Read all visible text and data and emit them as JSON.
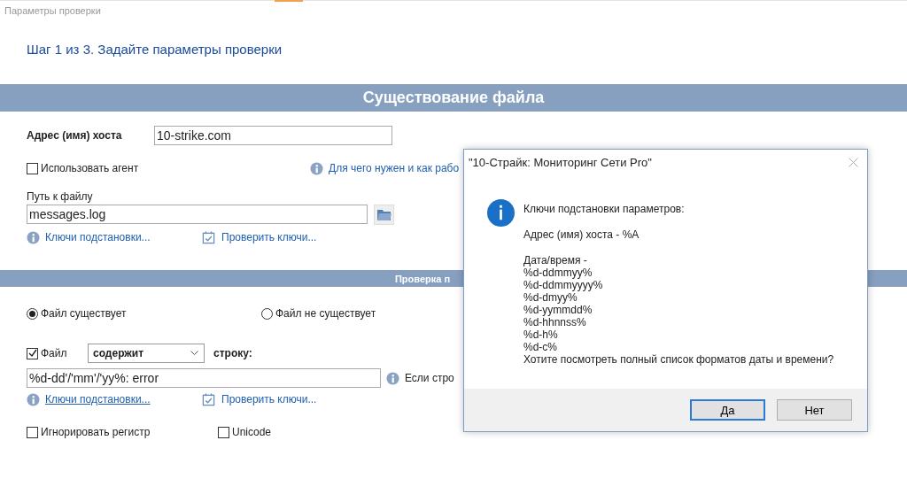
{
  "window": {
    "title": "Параметры проверки"
  },
  "step_heading": "Шаг 1 из 3. Задайте параметры проверки",
  "section_title": "Существование файла",
  "host": {
    "label": "Адрес (имя) хоста",
    "value": "10-strike.com"
  },
  "use_agent": {
    "label": "Использовать агент",
    "checked": false
  },
  "agent_help_link": "Для чего нужен и как рабо",
  "file_path": {
    "label": "Путь к файлу",
    "value": "messages.log"
  },
  "path_links": [
    {
      "kind": "info",
      "label": "Ключи подстановки...",
      "underlined": false
    },
    {
      "kind": "check",
      "label": "Проверить ключи...",
      "underlined": false
    }
  ],
  "subsection_title": "Проверка п",
  "existence": [
    {
      "label": "Файл существует",
      "selected": true
    },
    {
      "label": "Файл не существует",
      "selected": false
    }
  ],
  "contains": {
    "label": "Файл",
    "checked": true,
    "mode": "содержит",
    "suffix": "строку:"
  },
  "search_string": {
    "value": "%d-dd'/'mm'/'yy%: error",
    "hint": "Если стро"
  },
  "string_links": [
    {
      "kind": "info",
      "label": "Ключи подстановки...",
      "underlined": true
    },
    {
      "kind": "check",
      "label": "Проверить ключи...",
      "underlined": false
    }
  ],
  "options": [
    {
      "label": "Игнорировать регистр",
      "checked": false
    },
    {
      "label": "Unicode",
      "checked": false
    }
  ],
  "dialog": {
    "title": "\"10-Страйк: Мониторинг Сети Pro\"",
    "paragraphs": [
      [
        "Ключи подстановки параметров:"
      ],
      [
        "Адрес (имя) хоста - %A"
      ],
      [
        "Дата/время -",
        "%d-ddmmyy%",
        "%d-ddmmyyyy%",
        "%d-dmyy%",
        "%d-yymmdd%",
        "%d-hhnnss%",
        "%d-h%",
        "%d-c%",
        "Хотите посмотреть полный список форматов даты и времени?"
      ]
    ],
    "buttons": [
      {
        "label": "Да",
        "selected": true
      },
      {
        "label": "Нет",
        "selected": false
      }
    ]
  }
}
